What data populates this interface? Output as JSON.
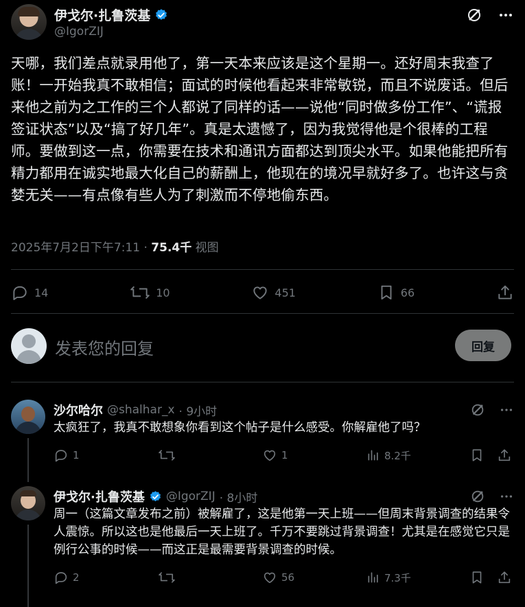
{
  "post": {
    "author_name": "伊戈尔·扎鲁茨基",
    "author_handle": "@IgorZIJ",
    "body": "天哪，我们差点就录用他了，第一天本来应该是这个星期一。还好周末我查了账！一开始我真不敢相信；面试的时候他看起来非常敏锐，而且不说废话。但后来他之前为之工作的三个人都说了同样的话——说他“同时做多份工作”、“谎报签证状态”以及“搞了好几年”。真是太遗憾了，因为我觉得他是个很棒的工程师。要做到这一点，你需要在技术和通讯方面都达到顶尖水平。如果他能把所有精力都用在诚实地最大化自己的薪酬上，他现在的境况早就好多了。也许这与贪婪无关——有点像有些人为了刺激而不停地偷东西。",
    "timestamp": "2025年7月2日下午7:11",
    "dot": " · ",
    "views": "75.4千",
    "views_label": " 视图",
    "stats": {
      "replies": "14",
      "reposts": "10",
      "likes": "451",
      "bookmarks": "66"
    }
  },
  "compose": {
    "placeholder": "发表您的回复",
    "button": "回复"
  },
  "replies": [
    {
      "author_name": "沙尔哈尔",
      "author_handle": "@shalhar_x",
      "time": "· 9小时",
      "text": "太疯狂了，我真不敢想象你看到这个帖子是什么感受。你解雇他了吗？",
      "replies": "1",
      "reposts": "",
      "likes": "1",
      "views": "8.2千"
    },
    {
      "author_name": "伊戈尔·扎鲁茨基",
      "author_handle": "@IgorZIJ",
      "time": "· 8小时",
      "text": "周一（这篇文章发布之前）被解雇了，这是他第一天上班——但周末背景调查的结果令人震惊。所以这也是他最后一天上班了。千万不要跳过背景调查！尤其是在感觉它只是例行公事的时候——而这正是最需要背景调查的时候。",
      "replies": "2",
      "reposts": "",
      "likes": "56",
      "views": "7.3千"
    }
  ],
  "colors": {
    "background": "#000000",
    "text": "#e7e9ea",
    "muted": "#71767b",
    "verified": "#1d9bf0"
  }
}
